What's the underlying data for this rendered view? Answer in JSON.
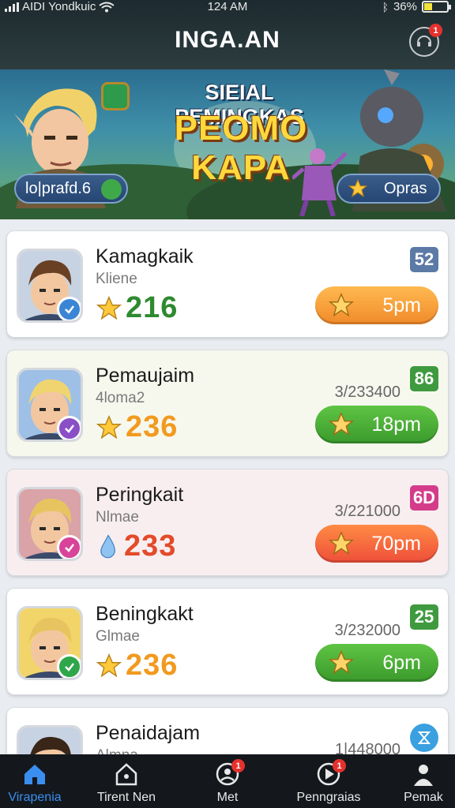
{
  "status_bar": {
    "carrier": "AIDI Yondkuic",
    "time": "124 AM",
    "battery": "36%",
    "battery_level": 0.36
  },
  "header": {
    "title": "INGA.AN",
    "support_badge": "1"
  },
  "banner": {
    "line1": "SIEIAL PEMINGKAS",
    "line2": "PEOMO KAPA",
    "left_pill": "lo|prafd.6",
    "right_pill": "Opras"
  },
  "rows": [
    {
      "name": "Kamagkaik",
      "sub": "Kliene",
      "score": "216",
      "stat": "",
      "rank": "52",
      "action": "5pm",
      "score_color": "#2f8a2f",
      "rank_color": "#5c7aa6",
      "action_style": "orange",
      "badge_color": "#3a86d4",
      "card_bg": "#ffffff",
      "icon": "star-icon"
    },
    {
      "name": "Pemaujaim",
      "sub": "4loma2",
      "score": "236",
      "stat": "3/233400",
      "rank": "86",
      "action": "18pm",
      "score_color": "#f29a1f",
      "rank_color": "#3f9a3f",
      "action_style": "green",
      "badge_color": "#8a4fc7",
      "card_bg": "#f6f8ee",
      "icon": "star-icon"
    },
    {
      "name": "Peringkait",
      "sub": "Nlmae",
      "score": "233",
      "stat": "3/221000",
      "rank": "6D",
      "action": "70pm",
      "score_color": "#e34b2a",
      "rank_color": "#d43c8a",
      "action_style": "red",
      "badge_color": "#d8449a",
      "card_bg": "#f8eef0",
      "icon": "water-drop-icon"
    },
    {
      "name": "Beningkakt",
      "sub": "Glmae",
      "score": "236",
      "stat": "3/232000",
      "rank": "25",
      "action": "6pm",
      "score_color": "#f29a1f",
      "rank_color": "#3f9a3f",
      "action_style": "green",
      "badge_color": "#2fa64a",
      "card_bg": "#ffffff",
      "icon": "star-icon"
    },
    {
      "name": "Penaidajam",
      "sub": "Almna",
      "score": "",
      "stat": "1|448000",
      "rank": "",
      "action": "",
      "score_color": "#f29a1f",
      "rank_color": "#3aa0e0",
      "action_style": "green",
      "badge_color": "#2fa64a",
      "card_bg": "#ffffff",
      "icon": "star-icon"
    }
  ],
  "nav": {
    "items": [
      {
        "label": "Virapenia",
        "icon": "home-icon",
        "active": true
      },
      {
        "label": "Tirent Nen",
        "icon": "house-outline-icon"
      },
      {
        "label": "Met",
        "icon": "user-circle-icon",
        "badge": "1"
      },
      {
        "label": "Penngraias",
        "icon": "play-circle-icon",
        "badge": "1"
      },
      {
        "label": "Pemak",
        "icon": "person-icon"
      }
    ]
  }
}
